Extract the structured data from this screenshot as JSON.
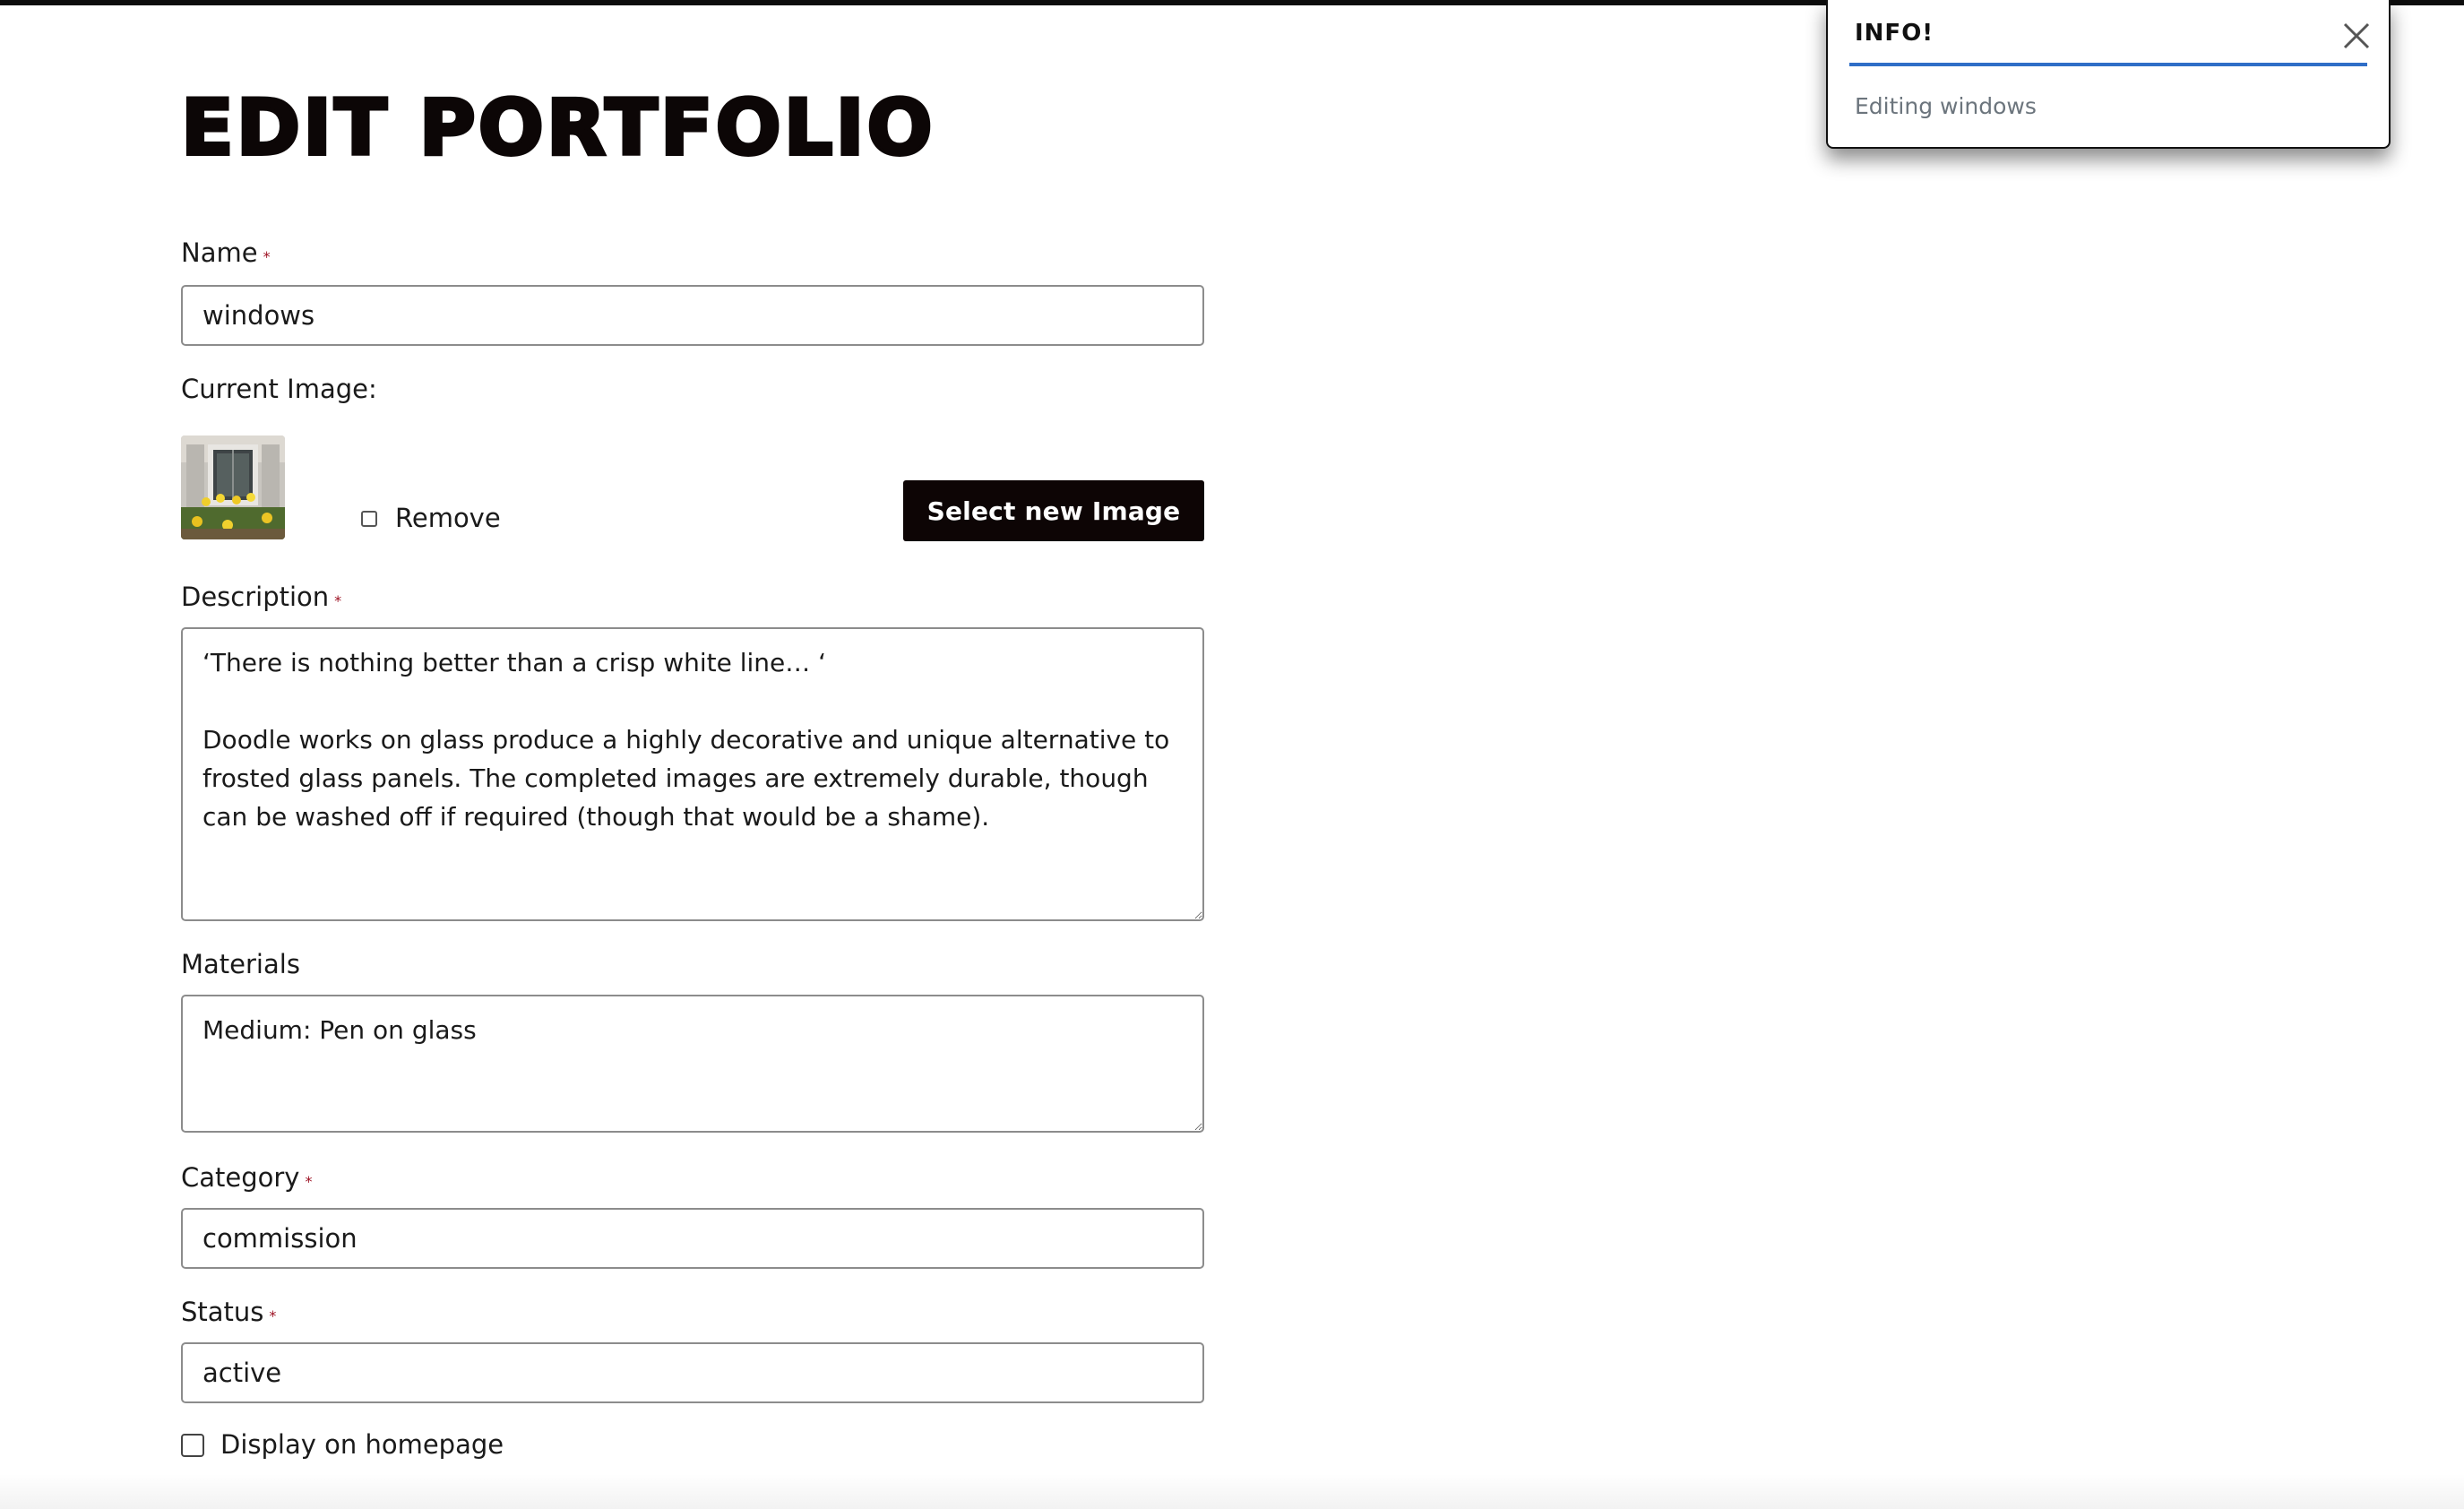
{
  "page": {
    "title": "Edit Portfolio"
  },
  "form": {
    "name": {
      "label": "Name",
      "required_mark": "*",
      "value": "windows"
    },
    "current_image": {
      "label": "Current Image:",
      "remove_label": "Remove",
      "remove_checked": false,
      "select_button_label": "Select new Image"
    },
    "description": {
      "label": "Description",
      "required_mark": "*",
      "value": "‘There is nothing better than a crisp white line… ‘\n\nDoodle works on glass produce a highly decorative and unique alternative to frosted glass panels. The completed images are extremely durable, though can be washed off if required (though that would be a shame)."
    },
    "materials": {
      "label": "Materials",
      "value": "Medium: Pen on glass"
    },
    "category": {
      "label": "Category",
      "required_mark": "*",
      "value": "commission"
    },
    "status": {
      "label": "Status",
      "required_mark": "*",
      "value": "active"
    },
    "display_on_homepage": {
      "label": "Display on homepage",
      "checked": false
    }
  },
  "toast": {
    "title": "INFO!",
    "message": "Editing windows",
    "close_icon": "close-icon",
    "accent_color": "#2f6ec7"
  },
  "colors": {
    "required": "#9b0d1f",
    "button_bg": "#0d0505",
    "top_bar": "#0d0d0d"
  }
}
